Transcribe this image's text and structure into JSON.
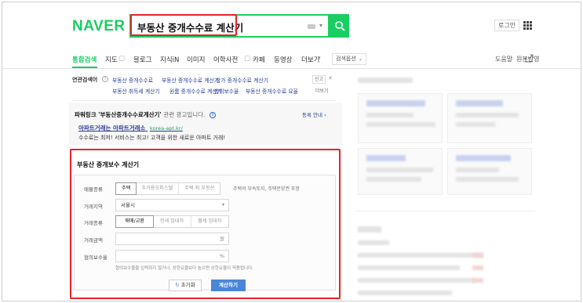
{
  "brand": {
    "logo": "NAVER",
    "accent": "#19ce60",
    "highlight": "#e5212b"
  },
  "search": {
    "query": "부동산 중개수수료 계산기"
  },
  "header": {
    "login_label": "로그인"
  },
  "nav": {
    "items": [
      "통합검색",
      "지도",
      "블로그",
      "지식iN",
      "이미지",
      "어학사전",
      "카페",
      "동영상",
      "더보기"
    ],
    "options_label": "검색옵션",
    "help_label": "도움말",
    "feedback_label": "원본반영"
  },
  "related": {
    "label": "연관검색어",
    "help": "?",
    "row1": [
      "부동산 중개수수료",
      "부동산 중개수수료 계산기",
      "상가 중개수수료 계산기"
    ],
    "row2": [
      "부동산 취득세 계산기",
      "원룸 중개수수료 계산기",
      "합의보수율",
      "부동산 중개수수료 요율"
    ],
    "report_label": "신고",
    "more_label": "더보기"
  },
  "powerlink": {
    "title": "파워링크",
    "query": "'부동산중개수수료계산기'",
    "subtitle": "관련 광고입니다.",
    "ad_register": "등록 안내",
    "headline": "아파트거래는 아파트거래소",
    "url": "korea-apt.kr/",
    "desc": "수수료는 최저! 서비스는 최고! 고객을 위한 새로운 아파트 거래!"
  },
  "calculator": {
    "title": "부동산 중개보수 계산기",
    "property_label": "매물종류",
    "property_options": [
      "주택",
      "주거용오피스텔",
      "주택 외 부동산"
    ],
    "property_hint": "주택의 부속토지, 주택분양권 포함",
    "region_label": "거래지역",
    "region_value": "서울시",
    "trade_label": "거래종류",
    "trade_options": [
      "매매/교환",
      "전세 임대차",
      "월세 임대차"
    ],
    "amount_label": "거래금액",
    "amount_unit": "원",
    "rate_label": "협의보수율",
    "rate_unit": "%",
    "rate_note": "협의보수율을 입력하지 않거나, 상한요율보다 높으면 상한요율이 적용됩니다.",
    "reset_label": "초기화",
    "calc_label": "계산하기"
  }
}
